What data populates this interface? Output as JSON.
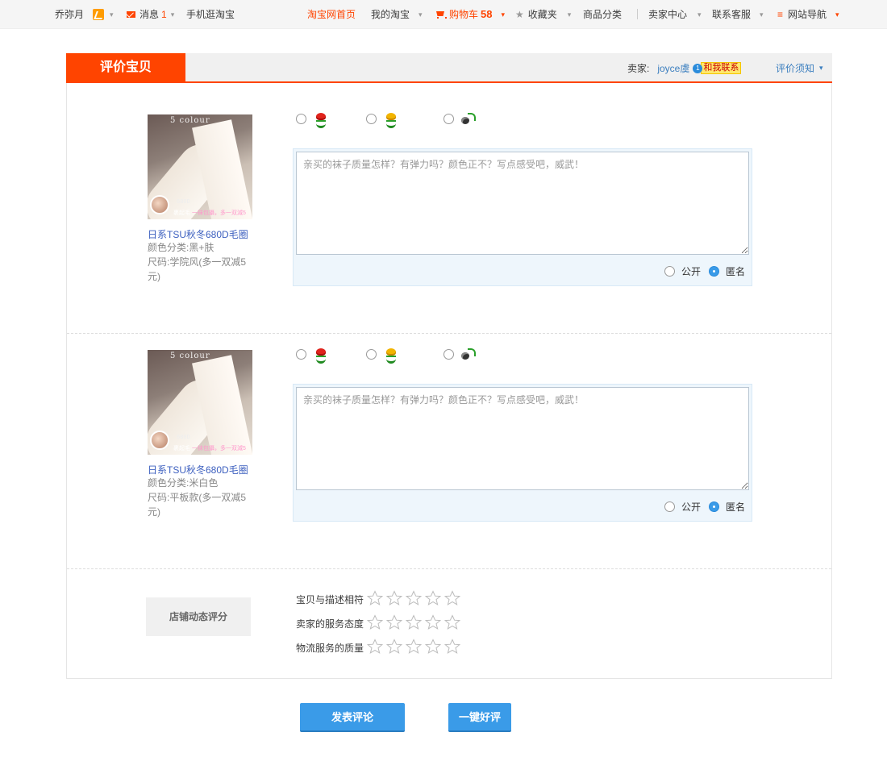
{
  "topbar": {
    "username": "乔弥月",
    "messages_label": "消息",
    "messages_count": "1",
    "mobile": "手机逛淘宝",
    "home": "淘宝网首页",
    "my_taobao": "我的淘宝",
    "cart_label": "购物车",
    "cart_count": "58",
    "favorites": "收藏夹",
    "categories": "商品分类",
    "seller_center": "卖家中心",
    "customer_service": "联系客服",
    "site_nav": "网站导航"
  },
  "header": {
    "tab_title": "评价宝贝",
    "seller_label": "卖家:",
    "seller_name": "joyce虞",
    "chat_badge": "1",
    "contact_label": "和我联系",
    "notice": "评价须知"
  },
  "items": [
    {
      "thumb_text": "5 colour",
      "thumb_code": "680D",
      "thumb_caption_1": "裹起毛",
      "thumb_caption_2": "一袜包攝，多一双減5",
      "title": "日系TSU秋冬680D毛圈",
      "color": "颜色分类:黑+肤",
      "size": "尺码:学院风(多一双减5元)",
      "comment_placeholder": "亲买的袜子质量怎样？有弹力吗？颜色正不？写点感受吧，威武！",
      "comment_value": "",
      "visibility_public": "公开",
      "visibility_anon": "匿名",
      "visibility_selected": "匿名",
      "rating_icons": [
        "red-flower-icon",
        "yellow-flower-icon",
        "bomb-icon"
      ]
    },
    {
      "thumb_text": "5 colour",
      "thumb_code": "680D",
      "thumb_caption_1": "裹起毛",
      "thumb_caption_2": "一袜包攝，多一双減5",
      "title": "日系TSU秋冬680D毛圈",
      "color": "颜色分类:米白色",
      "size": "尺码:平板款(多一双减5元)",
      "comment_placeholder": "亲买的袜子质量怎样？有弹力吗？颜色正不？写点感受吧，威武！",
      "comment_value": "",
      "visibility_public": "公开",
      "visibility_anon": "匿名",
      "visibility_selected": "匿名",
      "rating_icons": [
        "red-flower-icon",
        "yellow-flower-icon",
        "bomb-icon"
      ]
    }
  ],
  "shop_rating": {
    "button": "店铺动态评分",
    "rows": [
      {
        "label": "宝贝与描述相符",
        "stars": 0,
        "max": 5
      },
      {
        "label": "卖家的服务态度",
        "stars": 0,
        "max": 5
      },
      {
        "label": "物流服务的质量",
        "stars": 0,
        "max": 5
      }
    ]
  },
  "actions": {
    "submit": "发表评论",
    "quick_good": "一键好评"
  },
  "colors": {
    "accent": "#ff4400",
    "link": "#3c7fbf",
    "button": "#3a9be8",
    "comment_bg": "#eef6fc"
  }
}
